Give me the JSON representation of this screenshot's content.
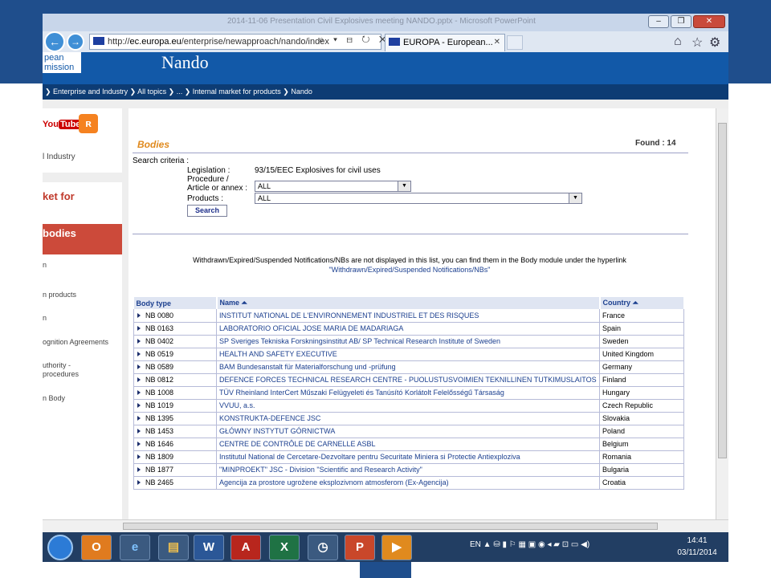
{
  "window": {
    "title": "2014-11-06 Presentation Civil Explosives meeting NANDO.pptx - Microsoft PowerPoint",
    "buttons": {
      "minimize": "–",
      "maximize": "❐",
      "close": "✕"
    }
  },
  "browser": {
    "back": "←",
    "forward": "→",
    "address_prefix": "http://",
    "address_domain": "ec.europa.eu",
    "address_path": "/enterprise/newapproach/nando/index",
    "address_tools": "⌕ ▾ ⊟ ↻ ✕",
    "tab_label": "EUROPA - European...",
    "tab_close": "✕",
    "right_icons": {
      "home": "⌂",
      "favorites": "☆",
      "settings": "⚙"
    }
  },
  "page": {
    "logo_line1": "pean",
    "logo_line2": "mission",
    "app_title": "Nando",
    "breadcrumb": "❯ Enterprise and Industry ❯ All topics ❯ ... ❯ Internal market for products ❯ Nando"
  },
  "sidebar": {
    "youtube": "You",
    "youtube_box": "Tube",
    "rss": "ʀ",
    "industry": "l Industry",
    "market": "ket for",
    "bodies": "bodies",
    "items": [
      "n",
      "n products",
      "n",
      "ognition Agreements",
      "uthority -",
      "procedures",
      "n Body"
    ]
  },
  "main": {
    "heading": "Bodies",
    "found_label": "Found : 14",
    "search_criteria": "Search criteria :",
    "legislation_label": "Legislation :",
    "legislation_value": "93/15/EEC Explosives for civil uses",
    "procedure_label": "Procedure /",
    "article_label": "Article or annex :",
    "article_value": "ALL",
    "products_label": "Products :",
    "products_value": "ALL",
    "search_button": "Search",
    "notice": "Withdrawn/Expired/Suspended Notifications/NBs are not displayed in this list, you can find them in the Body module under the hyperlink",
    "notice_link": "\"Withdrawn/Expired/Suspended Notifications/NBs\""
  },
  "table": {
    "headers": {
      "type": "Body type",
      "name": "Name ⏶",
      "country": "Country ⏶"
    },
    "rows": [
      {
        "type": "NB 0080",
        "name": "INSTITUT NATIONAL DE L'ENVIRONNEMENT INDUSTRIEL ET DES RISQUES",
        "country": "France"
      },
      {
        "type": "NB 0163",
        "name": "LABORATORIO OFICIAL JOSE MARIA DE MADARIAGA",
        "country": "Spain"
      },
      {
        "type": "NB 0402",
        "name": "SP Sveriges Tekniska Forskningsinstitut AB/ SP Technical Research Institute of Sweden",
        "country": "Sweden"
      },
      {
        "type": "NB 0519",
        "name": "HEALTH AND SAFETY EXECUTIVE",
        "country": "United Kingdom"
      },
      {
        "type": "NB 0589",
        "name": "BAM Bundesanstalt für Materialforschung und -prüfung",
        "country": "Germany"
      },
      {
        "type": "NB 0812",
        "name": "DEFENCE FORCES TECHNICAL RESEARCH CENTRE - PUOLUSTUSVOIMIEN TEKNILLINEN TUTKIMUSLAITOS",
        "country": "Finland"
      },
      {
        "type": "NB 1008",
        "name": "TÜV Rheinland InterCert Műszaki Felügyeleti és Tanúsító Korlátolt Felelősségű Társaság",
        "country": "Hungary"
      },
      {
        "type": "NB 1019",
        "name": "VVUU, a.s.",
        "country": "Czech Republic"
      },
      {
        "type": "NB 1395",
        "name": "KONSTRUKTA-DEFENCE JSC",
        "country": "Slovakia"
      },
      {
        "type": "NB 1453",
        "name": "GŁÓWNY INSTYTUT GÓRNICTWA",
        "country": "Poland"
      },
      {
        "type": "NB 1646",
        "name": "CENTRE DE CONTRÔLE DE CARNELLE ASBL",
        "country": "Belgium"
      },
      {
        "type": "NB 1809",
        "name": "Institutul National de Cercetare-Dezvoltare pentru Securitate Miniera si Protectie Antiexploziva",
        "country": "Romania"
      },
      {
        "type": "NB 1877",
        "name": "\"MINPROEKT\" JSC - Division \"Scientific and Research Activity\"",
        "country": "Bulgaria"
      },
      {
        "type": "NB 2465",
        "name": "Agencija za prostore ugrožene eksplozivnom atmosferom (Ex-Agencija)",
        "country": "Croatia"
      }
    ]
  },
  "taskbar": {
    "apps": [
      "O",
      "e",
      "▤",
      "W",
      "A",
      "X",
      "◷",
      "P",
      "▶"
    ],
    "tray": "EN   ▲ ⛁ ▮ ⚐ ▦ ▣ ◉ ◂ ▰ ⊡ ▭ ◀)",
    "time": "14:41",
    "date": "03/11/2014"
  }
}
